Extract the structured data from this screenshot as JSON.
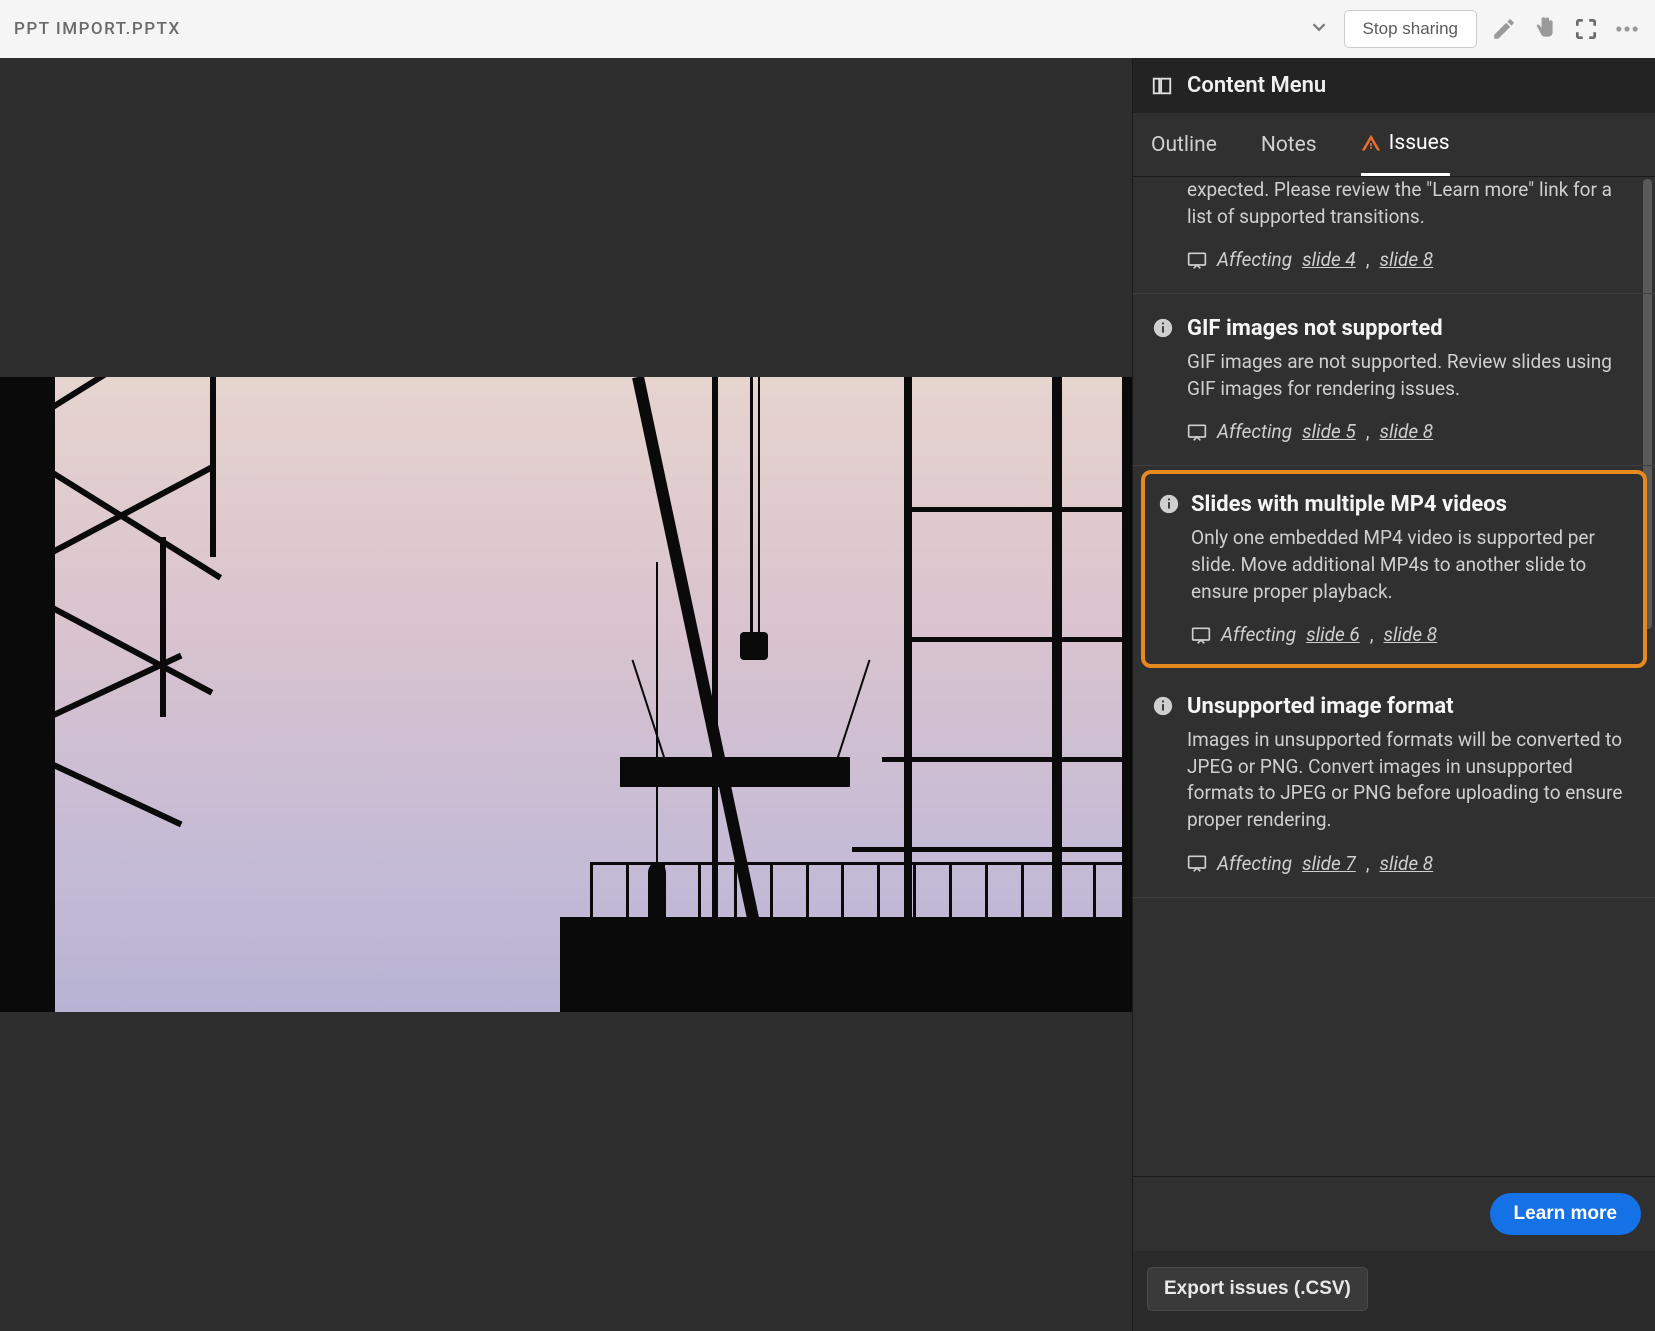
{
  "topbar": {
    "file_title": "PPT IMPORT.PPTX",
    "stop_sharing": "Stop sharing"
  },
  "panel": {
    "title": "Content Menu",
    "tabs": {
      "outline": "Outline",
      "notes": "Notes",
      "issues": "Issues"
    }
  },
  "issues": {
    "partial_top": {
      "desc_fragment": "expected. Please review the \"Learn more\" link for a list of supported transitions.",
      "affecting": "Affecting",
      "links": [
        "slide 4",
        "slide 8"
      ]
    },
    "gif": {
      "title": "GIF images not supported",
      "desc": "GIF images are not supported. Review slides using GIF images for rendering issues.",
      "affecting": "Affecting",
      "links": [
        "slide 5",
        "slide 8"
      ]
    },
    "mp4": {
      "title": "Slides with multiple MP4 videos",
      "desc": "Only one embedded MP4 video is supported per slide. Move additional MP4s to another slide to ensure proper playback.",
      "affecting": "Affecting",
      "links": [
        "slide 6",
        "slide 8"
      ]
    },
    "imgformat": {
      "title": "Unsupported image format",
      "desc": "Images in unsupported formats will be converted to JPEG or PNG. Convert images in unsupported formats to JPEG or PNG before uploading to ensure proper rendering.",
      "affecting": "Affecting",
      "links": [
        "slide 7",
        "slide 8"
      ]
    }
  },
  "footer": {
    "learn_more": "Learn more",
    "export": "Export issues (.CSV)"
  }
}
